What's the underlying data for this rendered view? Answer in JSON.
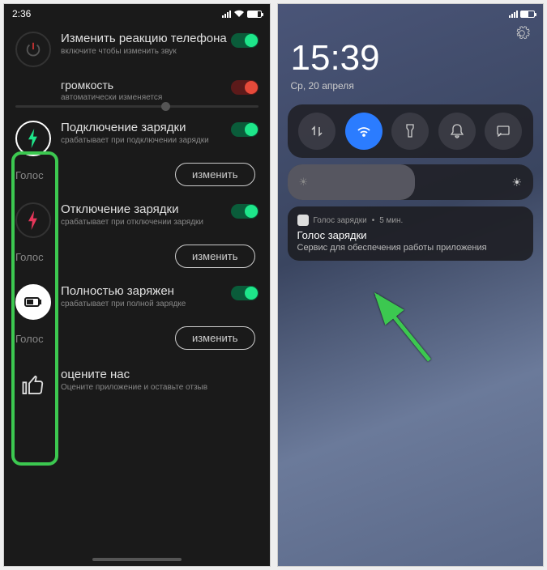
{
  "left": {
    "time": "2:36",
    "reaction": {
      "title": "Изменить реакцию телефона",
      "sub": "включите чтобы изменить звук"
    },
    "volume": {
      "title": "громкость",
      "sub": "автоматически изменяется"
    },
    "events": [
      {
        "title": "Подключение зарядки",
        "sub": "срабатывает при подключении зарядки",
        "voice": "Голос",
        "btn": "изменить"
      },
      {
        "title": "Отключение зарядки",
        "sub": "срабатывает при отключении зарядки",
        "voice": "Голос",
        "btn": "изменить"
      },
      {
        "title": "Полностью заряжен",
        "sub": "срабатывает при полной зарядке",
        "voice": "Голос",
        "btn": "изменить"
      }
    ],
    "rate": {
      "title": "оцените нас",
      "sub": "Оцените приложение и оставьте отзыв"
    }
  },
  "right": {
    "clock": "15:39",
    "date": "Ср, 20 апреля",
    "notif": {
      "app": "Голос зарядки",
      "time": "5 мин.",
      "title": "Голос зарядки",
      "body": "Сервис для обеспечения работы приложения"
    }
  }
}
